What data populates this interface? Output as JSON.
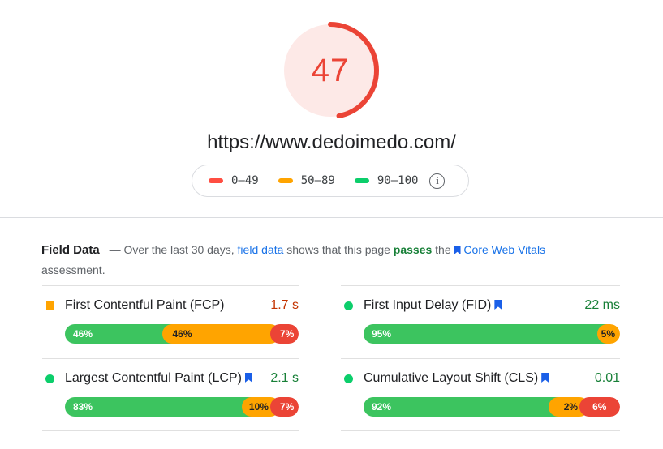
{
  "score": {
    "value": "47",
    "fraction": 0.47,
    "color": "#eb4436",
    "bg": "#fde9e7"
  },
  "url": "https://www.dedoimedo.com/",
  "legend": {
    "ranges": [
      {
        "label": "0–49",
        "color": "#ff4e42"
      },
      {
        "label": "50–89",
        "color": "#ffa400"
      },
      {
        "label": "90–100",
        "color": "#0cce6b"
      }
    ],
    "info_icon": "info-icon"
  },
  "field_data": {
    "title": "Field Data",
    "dash": "—",
    "text_1": "Over the last 30 days,",
    "link": "field data",
    "text_2": "shows that this page",
    "passes": "passes",
    "text_3": "the",
    "cwv_link": "Core Web Vitals",
    "text_4": "assessment."
  },
  "metrics": [
    {
      "name": "First Contentful Paint (FCP)",
      "value": "1.7 s",
      "value_color": "#c33300",
      "status": "average",
      "cwv": false,
      "dist": [
        {
          "pct": 46,
          "label": "46%"
        },
        {
          "pct": 46,
          "label": "46%"
        },
        {
          "pct": 7,
          "label": "7%"
        }
      ]
    },
    {
      "name": "First Input Delay (FID)",
      "value": "22 ms",
      "value_color": "#188038",
      "status": "good",
      "cwv": true,
      "dist": [
        {
          "pct": 95,
          "label": "95%"
        },
        {
          "pct": 5,
          "label": "5%"
        }
      ]
    },
    {
      "name": "Largest Contentful Paint (LCP)",
      "value": "2.1 s",
      "value_color": "#188038",
      "status": "good",
      "cwv": true,
      "dist": [
        {
          "pct": 83,
          "label": "83%"
        },
        {
          "pct": 10,
          "label": "10%"
        },
        {
          "pct": 7,
          "label": "7%"
        }
      ]
    },
    {
      "name": "Cumulative Layout Shift (CLS)",
      "value": "0.01",
      "value_color": "#188038",
      "status": "good",
      "cwv": true,
      "dist": [
        {
          "pct": 92,
          "label": "92%"
        },
        {
          "pct": 2,
          "label": "2%"
        },
        {
          "pct": 6,
          "label": "6%"
        }
      ]
    }
  ]
}
